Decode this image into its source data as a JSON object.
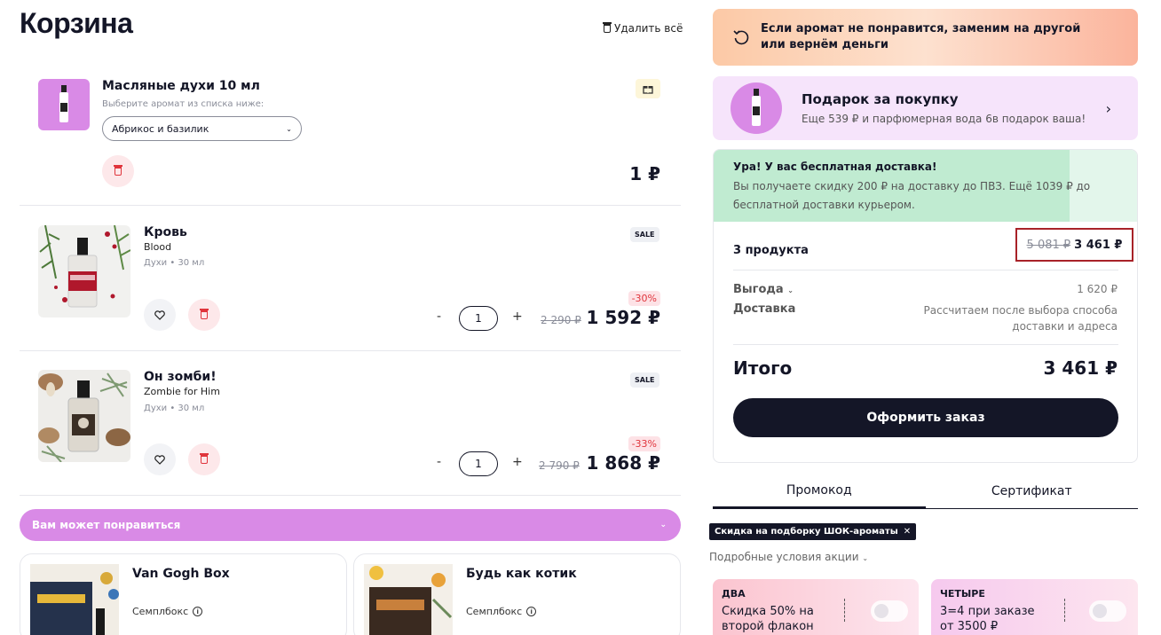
{
  "header": {
    "title": "Корзина",
    "delete_all": "Удалить всё"
  },
  "items": [
    {
      "title": "Масляные духи 10 мл",
      "hint": "Выберите аромат из списка ниже:",
      "selected_scent": "Абрикос и базилик",
      "price": "1 ₽",
      "icons": {
        "badge": "gift-icon",
        "delete": "trash-icon"
      }
    },
    {
      "title": "Кровь",
      "subtitle": "Blood",
      "meta": "Духи • 30 мл",
      "badge": "SALE",
      "discount": "-30%",
      "quantity": "1",
      "old_price": "2 290 ₽",
      "price": "1 592 ₽",
      "minus": "-",
      "plus": "+"
    },
    {
      "title": "Он зомби!",
      "subtitle": "Zombie for Him",
      "meta": "Духи • 30 мл",
      "badge": "SALE",
      "discount": "-33%",
      "quantity": "1",
      "old_price": "2 790 ₽",
      "price": "1 868 ₽",
      "minus": "-",
      "plus": "+"
    }
  ],
  "suggestions": {
    "title": "Вам может понравиться",
    "cards": [
      {
        "title": "Van Gogh Box",
        "subtitle": "Семплбокс"
      },
      {
        "title": "Будь как котик",
        "subtitle": "Семплбокс"
      }
    ]
  },
  "right": {
    "guarantee": "Если аромат не понравится, заменим на другой или вернём деньги",
    "gift": {
      "title": "Подарок за покупку",
      "subtitle": "Еще 539 ₽ и парфюмерная вода 6в подарок ваша!"
    },
    "shipping": {
      "title": "Ура! У вас бесплатная доставка!",
      "text": "Вы получаете скидку 200 ₽ на доставку до ПВЗ. Ещё 1039 ₽ до бесплатной доставки курьером.",
      "progress": 0.84
    },
    "summary": {
      "products_label": "3 продукта",
      "products_old": "5 081 ₽",
      "products_new": "3 461 ₽",
      "benefit_label": "Выгода",
      "benefit_value": "1 620 ₽",
      "delivery_label": "Доставка",
      "delivery_value": "Рассчитаем после выбора способа доставки и адреса",
      "total_label": "Итого",
      "total_value": "3 461 ₽",
      "checkout": "Оформить заказ"
    },
    "tabs": [
      "Промокод",
      "Сертификат"
    ],
    "applied_promo": "Скидка на подборку ШОК-ароматы",
    "conditions": "Подробные условия акции",
    "offers": [
      {
        "name": "ДВА",
        "text": "Скидка 50% на второй флакон",
        "color": "#fbc4cf"
      },
      {
        "name": "ЧЕТЫРЕ",
        "text": "3=4 при заказе от 3500 ₽",
        "color": "#f6c9ee"
      }
    ]
  },
  "colors": {
    "accent": "#d98ae6",
    "dark": "#141627",
    "sale": "#e0353c",
    "ship_fill": "#c0ebd1"
  }
}
